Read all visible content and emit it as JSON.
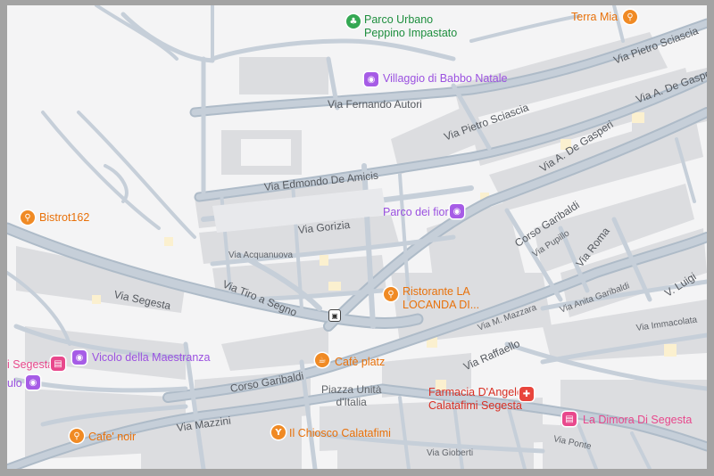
{
  "map": {
    "colors": {
      "background": "#f4f4f5",
      "road": "#c6cfd9",
      "road_outline": "#aebbc8",
      "building": "#dcdde0",
      "highlight": "#fbf0cf",
      "poi_orange": "#e8710a",
      "poi_purple": "#9b51e0",
      "poi_green": "#1e8e3e",
      "poi_red": "#d93025"
    },
    "streets": {
      "via_fernando_autori": "Via Fernando Autori",
      "via_pietro_sciascia_1": "Via Pietro Sciascia",
      "via_pietro_sciascia_2": "Via Pietro Sciascia",
      "via_a_de_gasperi_1": "Via A. De Gaspe",
      "via_a_de_gasperi_2": "Via A. De Gasperi",
      "via_a_de_gasperi_3": "Via A. De Gasperi",
      "via_edmondo_de_amicis": "Via Edmondo De Amicis",
      "via_gorizia": "Via Gorizia",
      "via_acquanuova": "Via Acquanuova",
      "corso_garibaldi_1": "Corso Garibaldi",
      "corso_garibaldi_2": "Corso Garibaldi",
      "via_pupillo": "Via Pupillo",
      "via_roma": "Via Roma",
      "via_luigi": "V. Luigi",
      "via_segesta": "Via Segesta",
      "via_tiro_a_segno": "Via Tiro a Segno",
      "via_m_mazzara": "Via M. Mazzara",
      "via_anita_garibaldi": "Via Anita Garibaldi",
      "via_immacolata": "Via Immacolata",
      "via_raffaello": "Via Raffaello",
      "via_mazzini": "Via Mazzini",
      "via_gioberti": "Via Gioberti",
      "via_ponte": "Via Ponte",
      "piazza": "Piazza Unità\nd'Italia"
    },
    "pois": {
      "parco_urbano": "Parco Urbano\nPeppino Impastato",
      "terra_mia": "Terra Mia",
      "villaggio": "Villaggio di Babbo Natale",
      "bistrot": "Bistrot162",
      "parco_fiori": "Parco dei fiori",
      "locanda": "Ristorante LA\nLOCANDA DI...",
      "vicolo": "Vicolo della Maestranza",
      "segesta_left": "i Segesta",
      "ulo_left": "ulo",
      "cafe_platz": "Cafè platz",
      "farmacia": "Farmacia D'Angelo\nCalatafimi Segesta",
      "dimora": "La Dimora Di Segesta",
      "chiosco": "Il Chiosco Calatafimi",
      "cafe_noir": "Cafe' noir",
      "bus_icon": "bus-stop"
    }
  }
}
